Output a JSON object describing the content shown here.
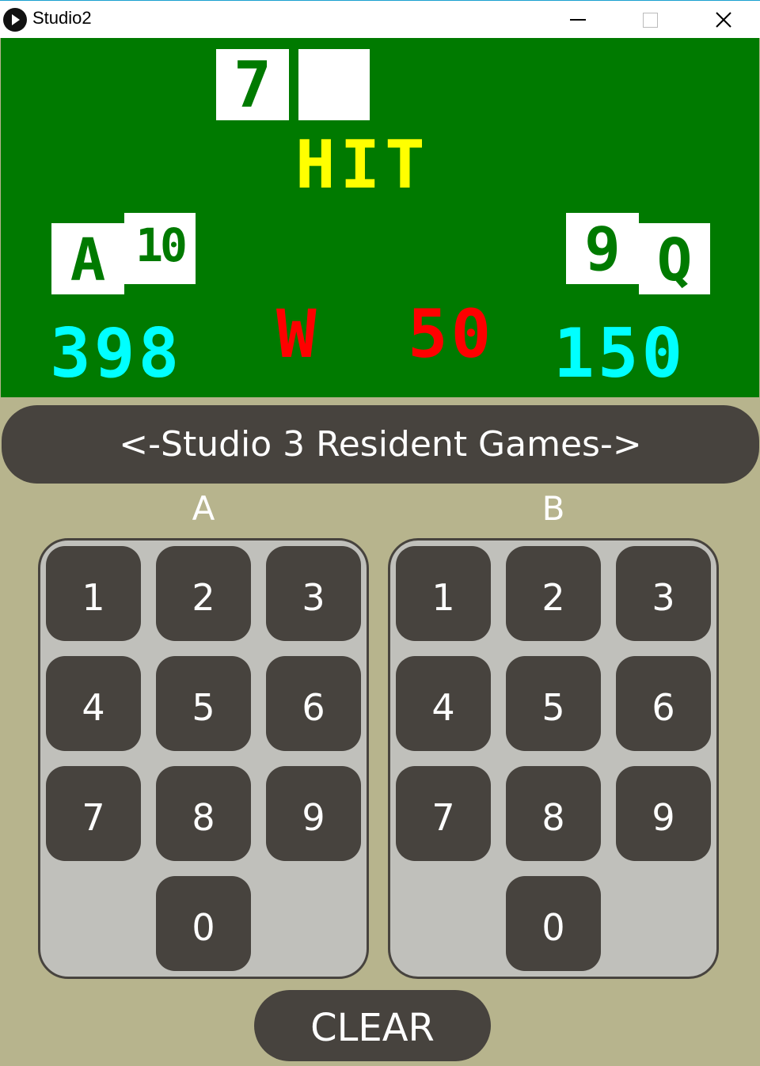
{
  "window": {
    "title": "Studio2"
  },
  "game": {
    "top_card": "7",
    "status": "HIT",
    "player_a": {
      "card_1": "A",
      "card_2": "10",
      "score": "398"
    },
    "center": {
      "result": "W",
      "bet": "50"
    },
    "player_b": {
      "card_1": "9",
      "card_2": "Q",
      "score": "150"
    },
    "colors": {
      "screen_bg": "#007a00",
      "status": "#ffff00",
      "score": "#00ffff",
      "center": "#ff0000",
      "card_bg": "#ffffff"
    }
  },
  "controls": {
    "games_button": "<-Studio 3 Resident Games->",
    "pad_a": {
      "label": "A",
      "keys": [
        "1",
        "2",
        "3",
        "4",
        "5",
        "6",
        "7",
        "8",
        "9",
        "0"
      ]
    },
    "pad_b": {
      "label": "B",
      "keys": [
        "1",
        "2",
        "3",
        "4",
        "5",
        "6",
        "7",
        "8",
        "9",
        "0"
      ]
    },
    "clear_button": "CLEAR"
  }
}
